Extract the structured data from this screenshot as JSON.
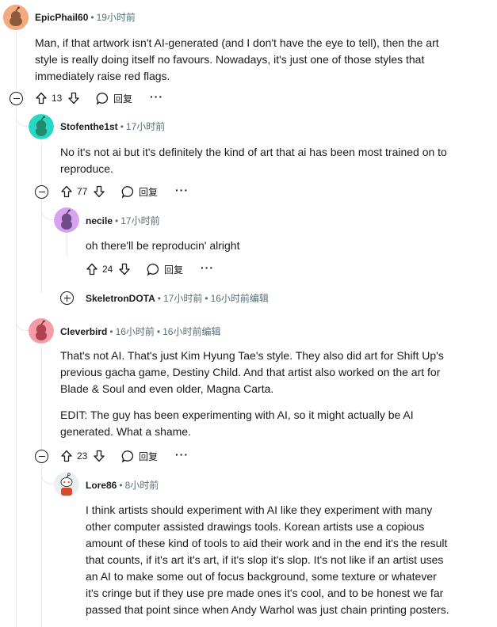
{
  "comments": {
    "c1": {
      "username": "EpicPhail60",
      "time": "19小时前",
      "text": "Man, if that artwork isn't AI-generated (and I don't have the eye to tell), then the art style is really doing itself no favours. Nowadays, it's just one of those styles that immediately raise red flags.",
      "votes": "13",
      "reply_label": "回复",
      "more_label": "···"
    },
    "c2": {
      "username": "Stofenthe1st",
      "time": "17小时前",
      "text": "No it's not ai but it's definitely the kind of art that ai has been most trained on to reproduce.",
      "votes": "77",
      "reply_label": "回复",
      "more_label": "···"
    },
    "c3": {
      "username": "necile",
      "time": "17小时前",
      "text": "oh there'll be reproducin' alright",
      "votes": "24",
      "reply_label": "回复",
      "more_label": "···"
    },
    "c4": {
      "username": "SkeletronDOTA",
      "time": "17小时前",
      "edited_time": "16小时前",
      "edited_label": "编辑"
    },
    "c5": {
      "username": "Cleverbird",
      "time": "16小时前",
      "edited_time": "16小时前",
      "edited_label": "编辑",
      "paragraph1": "That's not AI. That's just Kim Hyung Tae's style. They also did art for Shift Up's previous gacha game, Destiny Child. And that artist also worked on the art for Blade & Soul and even older, Magna Carta.",
      "paragraph2": "EDIT: The guy has been experimenting with AI, so it might actually be AI generated. What a shame.",
      "votes": "23",
      "reply_label": "回复",
      "more_label": "···"
    },
    "c6": {
      "username": "Lore86",
      "time": "8小时前",
      "text": "I think artists should experiment with AI like they experiment with many other computer assisted drawings tools. Korean artists use a copious amount of these kind of tools to aid their work and in the end it's the result that counts, if it's art it's art, if it's slop it's slop. It's not like if an artist uses an AI to make some out of focus background, some texture or whatever it's cringe but if they use pre made ones it's cool, and to be honest we far passed that point since when Andy Warhol was just chain printing posters."
    }
  },
  "colors": {
    "avatar_c1": "#f5a97f",
    "avatar_c2": "#28d7c3",
    "avatar_c3": "#d6a3f0",
    "avatar_c5": "#f49ba8",
    "avatar_c6": "#e9f0f3",
    "thread_line": "#e5ebee",
    "meta_text": "#576f76"
  },
  "icons": {
    "upvote": "arrow-up-outline",
    "downvote": "arrow-down-outline",
    "reply": "speech-bubble-outline",
    "collapse": "circle-minus",
    "expand": "circle-plus"
  }
}
